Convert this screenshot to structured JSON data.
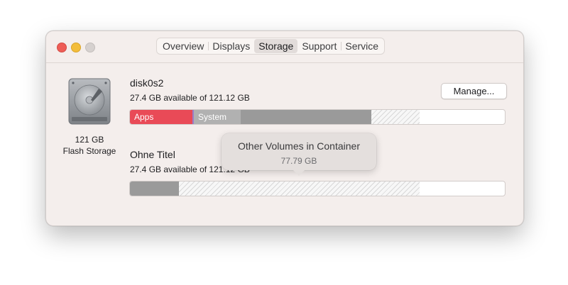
{
  "tabs": [
    {
      "label": "Overview",
      "active": false
    },
    {
      "label": "Displays",
      "active": false
    },
    {
      "label": "Storage",
      "active": true
    },
    {
      "label": "Support",
      "active": false
    },
    {
      "label": "Service",
      "active": false
    }
  ],
  "disk": {
    "capacity": "121 GB",
    "type": "Flash Storage",
    "icon": "hard-drive-icon"
  },
  "volumes": [
    {
      "name": "disk0s2",
      "info": "27.4 GB available of 121.12 GB",
      "segments": [
        {
          "label": "Apps",
          "color": "#e94a57"
        },
        {
          "label": "System",
          "color": "#b1b1b1"
        },
        {
          "label": "",
          "color": "#9a9a9a"
        },
        {
          "label": "",
          "pattern": "hatched"
        }
      ]
    },
    {
      "name": "Ohne Titel",
      "info": "27.4 GB available of 121.12 GB",
      "segments": [
        {
          "label": "",
          "color": "#9a9a9a"
        },
        {
          "label": "",
          "pattern": "hatched"
        }
      ]
    }
  ],
  "manage_label": "Manage...",
  "tooltip": {
    "title": "Other Volumes in Container",
    "value": "77.79 GB"
  },
  "colors": {
    "window_bg": "#f4eeec",
    "close": "#ee5d57",
    "minimize": "#f3bd3b",
    "zoom_inactive": "#d6d1cf",
    "apps": "#e94a57",
    "system": "#b1b1b1",
    "other": "#9a9a9a"
  }
}
